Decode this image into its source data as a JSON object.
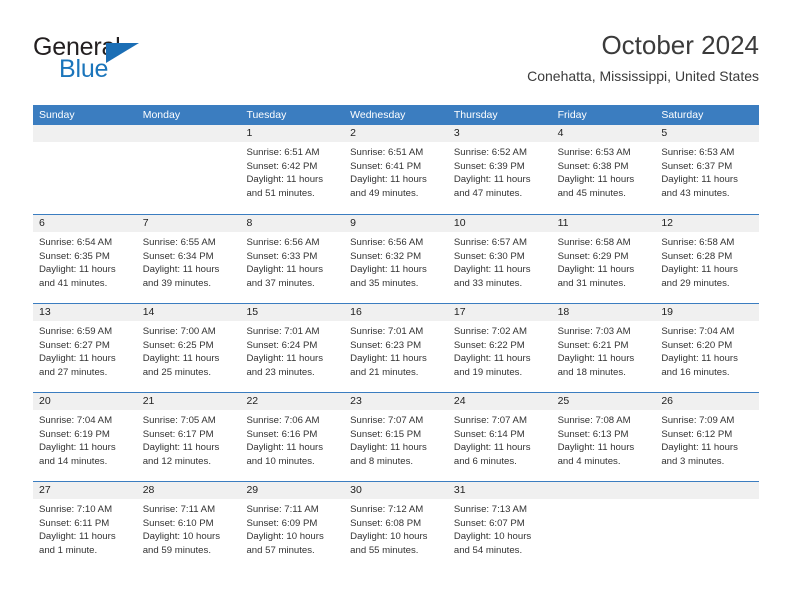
{
  "brand": {
    "name_part1": "General",
    "name_part2": "Blue",
    "logo_icon": "blue-triangle-icon"
  },
  "header": {
    "title": "October 2024",
    "location": "Conehatta, Mississippi, United States"
  },
  "colors": {
    "header_blue": "#3b7dc0",
    "brand_blue": "#1b75bb",
    "day_band_gray": "#f0f0f0",
    "text_dark": "#333333"
  },
  "calendar": {
    "weekdays": [
      "Sunday",
      "Monday",
      "Tuesday",
      "Wednesday",
      "Thursday",
      "Friday",
      "Saturday"
    ],
    "weeks": [
      [
        {
          "day": "",
          "empty": true,
          "sunrise": "",
          "sunset": "",
          "daylight1": "",
          "daylight2": ""
        },
        {
          "day": "",
          "empty": true,
          "sunrise": "",
          "sunset": "",
          "daylight1": "",
          "daylight2": ""
        },
        {
          "day": "1",
          "sunrise": "Sunrise: 6:51 AM",
          "sunset": "Sunset: 6:42 PM",
          "daylight1": "Daylight: 11 hours",
          "daylight2": "and 51 minutes."
        },
        {
          "day": "2",
          "sunrise": "Sunrise: 6:51 AM",
          "sunset": "Sunset: 6:41 PM",
          "daylight1": "Daylight: 11 hours",
          "daylight2": "and 49 minutes."
        },
        {
          "day": "3",
          "sunrise": "Sunrise: 6:52 AM",
          "sunset": "Sunset: 6:39 PM",
          "daylight1": "Daylight: 11 hours",
          "daylight2": "and 47 minutes."
        },
        {
          "day": "4",
          "sunrise": "Sunrise: 6:53 AM",
          "sunset": "Sunset: 6:38 PM",
          "daylight1": "Daylight: 11 hours",
          "daylight2": "and 45 minutes."
        },
        {
          "day": "5",
          "sunrise": "Sunrise: 6:53 AM",
          "sunset": "Sunset: 6:37 PM",
          "daylight1": "Daylight: 11 hours",
          "daylight2": "and 43 minutes."
        }
      ],
      [
        {
          "day": "6",
          "sunrise": "Sunrise: 6:54 AM",
          "sunset": "Sunset: 6:35 PM",
          "daylight1": "Daylight: 11 hours",
          "daylight2": "and 41 minutes."
        },
        {
          "day": "7",
          "sunrise": "Sunrise: 6:55 AM",
          "sunset": "Sunset: 6:34 PM",
          "daylight1": "Daylight: 11 hours",
          "daylight2": "and 39 minutes."
        },
        {
          "day": "8",
          "sunrise": "Sunrise: 6:56 AM",
          "sunset": "Sunset: 6:33 PM",
          "daylight1": "Daylight: 11 hours",
          "daylight2": "and 37 minutes."
        },
        {
          "day": "9",
          "sunrise": "Sunrise: 6:56 AM",
          "sunset": "Sunset: 6:32 PM",
          "daylight1": "Daylight: 11 hours",
          "daylight2": "and 35 minutes."
        },
        {
          "day": "10",
          "sunrise": "Sunrise: 6:57 AM",
          "sunset": "Sunset: 6:30 PM",
          "daylight1": "Daylight: 11 hours",
          "daylight2": "and 33 minutes."
        },
        {
          "day": "11",
          "sunrise": "Sunrise: 6:58 AM",
          "sunset": "Sunset: 6:29 PM",
          "daylight1": "Daylight: 11 hours",
          "daylight2": "and 31 minutes."
        },
        {
          "day": "12",
          "sunrise": "Sunrise: 6:58 AM",
          "sunset": "Sunset: 6:28 PM",
          "daylight1": "Daylight: 11 hours",
          "daylight2": "and 29 minutes."
        }
      ],
      [
        {
          "day": "13",
          "sunrise": "Sunrise: 6:59 AM",
          "sunset": "Sunset: 6:27 PM",
          "daylight1": "Daylight: 11 hours",
          "daylight2": "and 27 minutes."
        },
        {
          "day": "14",
          "sunrise": "Sunrise: 7:00 AM",
          "sunset": "Sunset: 6:25 PM",
          "daylight1": "Daylight: 11 hours",
          "daylight2": "and 25 minutes."
        },
        {
          "day": "15",
          "sunrise": "Sunrise: 7:01 AM",
          "sunset": "Sunset: 6:24 PM",
          "daylight1": "Daylight: 11 hours",
          "daylight2": "and 23 minutes."
        },
        {
          "day": "16",
          "sunrise": "Sunrise: 7:01 AM",
          "sunset": "Sunset: 6:23 PM",
          "daylight1": "Daylight: 11 hours",
          "daylight2": "and 21 minutes."
        },
        {
          "day": "17",
          "sunrise": "Sunrise: 7:02 AM",
          "sunset": "Sunset: 6:22 PM",
          "daylight1": "Daylight: 11 hours",
          "daylight2": "and 19 minutes."
        },
        {
          "day": "18",
          "sunrise": "Sunrise: 7:03 AM",
          "sunset": "Sunset: 6:21 PM",
          "daylight1": "Daylight: 11 hours",
          "daylight2": "and 18 minutes."
        },
        {
          "day": "19",
          "sunrise": "Sunrise: 7:04 AM",
          "sunset": "Sunset: 6:20 PM",
          "daylight1": "Daylight: 11 hours",
          "daylight2": "and 16 minutes."
        }
      ],
      [
        {
          "day": "20",
          "sunrise": "Sunrise: 7:04 AM",
          "sunset": "Sunset: 6:19 PM",
          "daylight1": "Daylight: 11 hours",
          "daylight2": "and 14 minutes."
        },
        {
          "day": "21",
          "sunrise": "Sunrise: 7:05 AM",
          "sunset": "Sunset: 6:17 PM",
          "daylight1": "Daylight: 11 hours",
          "daylight2": "and 12 minutes."
        },
        {
          "day": "22",
          "sunrise": "Sunrise: 7:06 AM",
          "sunset": "Sunset: 6:16 PM",
          "daylight1": "Daylight: 11 hours",
          "daylight2": "and 10 minutes."
        },
        {
          "day": "23",
          "sunrise": "Sunrise: 7:07 AM",
          "sunset": "Sunset: 6:15 PM",
          "daylight1": "Daylight: 11 hours",
          "daylight2": "and 8 minutes."
        },
        {
          "day": "24",
          "sunrise": "Sunrise: 7:07 AM",
          "sunset": "Sunset: 6:14 PM",
          "daylight1": "Daylight: 11 hours",
          "daylight2": "and 6 minutes."
        },
        {
          "day": "25",
          "sunrise": "Sunrise: 7:08 AM",
          "sunset": "Sunset: 6:13 PM",
          "daylight1": "Daylight: 11 hours",
          "daylight2": "and 4 minutes."
        },
        {
          "day": "26",
          "sunrise": "Sunrise: 7:09 AM",
          "sunset": "Sunset: 6:12 PM",
          "daylight1": "Daylight: 11 hours",
          "daylight2": "and 3 minutes."
        }
      ],
      [
        {
          "day": "27",
          "sunrise": "Sunrise: 7:10 AM",
          "sunset": "Sunset: 6:11 PM",
          "daylight1": "Daylight: 11 hours",
          "daylight2": "and 1 minute."
        },
        {
          "day": "28",
          "sunrise": "Sunrise: 7:11 AM",
          "sunset": "Sunset: 6:10 PM",
          "daylight1": "Daylight: 10 hours",
          "daylight2": "and 59 minutes."
        },
        {
          "day": "29",
          "sunrise": "Sunrise: 7:11 AM",
          "sunset": "Sunset: 6:09 PM",
          "daylight1": "Daylight: 10 hours",
          "daylight2": "and 57 minutes."
        },
        {
          "day": "30",
          "sunrise": "Sunrise: 7:12 AM",
          "sunset": "Sunset: 6:08 PM",
          "daylight1": "Daylight: 10 hours",
          "daylight2": "and 55 minutes."
        },
        {
          "day": "31",
          "sunrise": "Sunrise: 7:13 AM",
          "sunset": "Sunset: 6:07 PM",
          "daylight1": "Daylight: 10 hours",
          "daylight2": "and 54 minutes."
        },
        {
          "day": "",
          "empty": true,
          "sunrise": "",
          "sunset": "",
          "daylight1": "",
          "daylight2": ""
        },
        {
          "day": "",
          "empty": true,
          "sunrise": "",
          "sunset": "",
          "daylight1": "",
          "daylight2": ""
        }
      ]
    ]
  }
}
